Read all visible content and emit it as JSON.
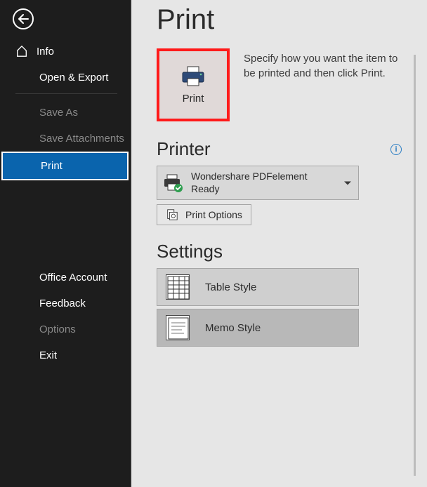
{
  "sidebar": {
    "info": "Info",
    "open_export": "Open & Export",
    "save_as": "Save As",
    "save_attachments": "Save Attachments",
    "print": "Print",
    "office_account": "Office Account",
    "feedback": "Feedback",
    "options": "Options",
    "exit": "Exit"
  },
  "main": {
    "title": "Print",
    "print_button_label": "Print",
    "description": "Specify how you want the item to be printed and then click Print.",
    "printer_heading": "Printer",
    "printer_name": "Wondershare PDFelement",
    "printer_status": "Ready",
    "print_options": "Print Options",
    "settings_heading": "Settings",
    "styles": [
      {
        "label": "Table Style"
      },
      {
        "label": "Memo Style"
      }
    ]
  }
}
